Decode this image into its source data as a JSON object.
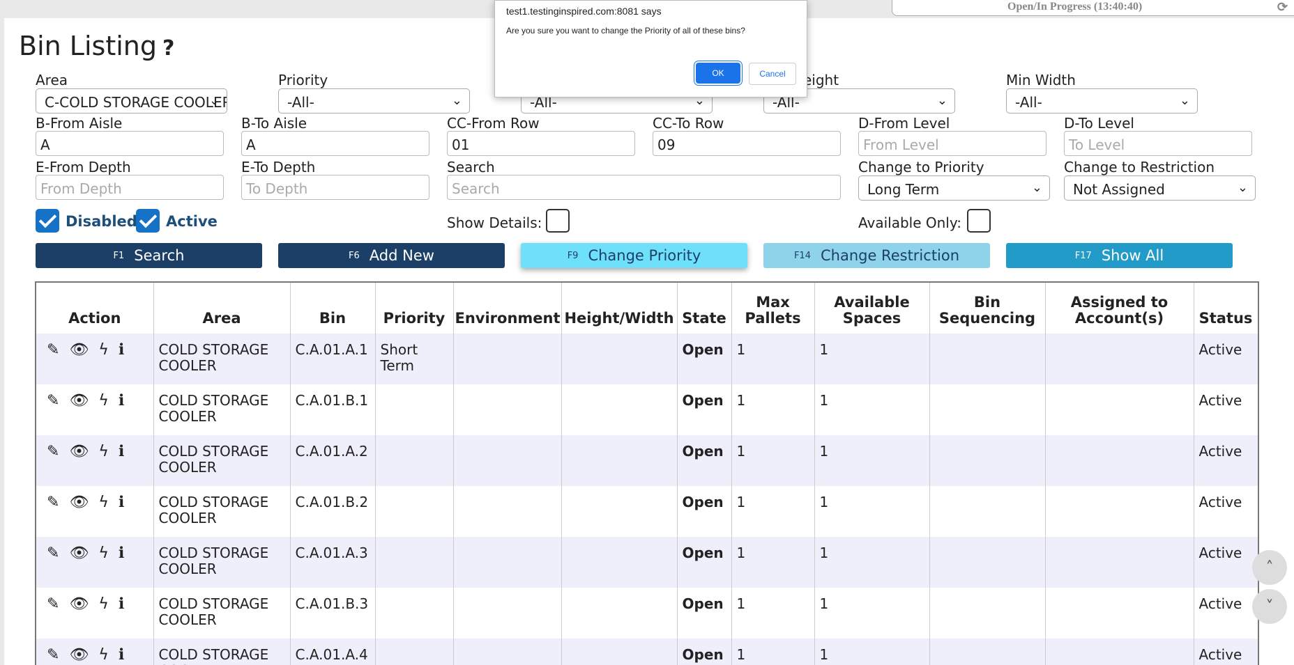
{
  "status": {
    "text": "Open/In Progress (13:40:40)",
    "refresh_icon": "refresh-icon"
  },
  "page": {
    "title": "Bin Listing",
    "help": "?"
  },
  "filters": {
    "area": {
      "label": "Area",
      "value": "C-COLD STORAGE COOLER"
    },
    "priority": {
      "label": "Priority",
      "value": "-All-"
    },
    "environment": {
      "label": "",
      "value": "-All-"
    },
    "min_height": {
      "label": "eight",
      "value": "-All-"
    },
    "min_width": {
      "label": "Min Width",
      "value": "-All-"
    },
    "from_aisle": {
      "label": "B-From Aisle",
      "value": "A"
    },
    "to_aisle": {
      "label": "B-To Aisle",
      "value": "A"
    },
    "from_row": {
      "label": "CC-From Row",
      "value": "01"
    },
    "to_row": {
      "label": "CC-To Row",
      "value": "09"
    },
    "from_level": {
      "label": "D-From Level",
      "placeholder": "From Level"
    },
    "to_level": {
      "label": "D-To Level",
      "placeholder": "To Level"
    },
    "from_depth": {
      "label": "E-From Depth",
      "placeholder": "From Depth"
    },
    "to_depth": {
      "label": "E-To Depth",
      "placeholder": "To Depth"
    },
    "search": {
      "label": "Search",
      "placeholder": "Search"
    },
    "change_priority": {
      "label": "Change to Priority",
      "value": "Long Term"
    },
    "change_restriction": {
      "label": "Change to Restriction",
      "value": "Not Assigned"
    },
    "disabled": {
      "label": "Disabled",
      "checked": true
    },
    "active": {
      "label": "Active",
      "checked": true
    },
    "show_details": {
      "label": "Show Details:",
      "checked": false
    },
    "available_only": {
      "label": "Available Only:",
      "checked": false
    }
  },
  "buttons": {
    "search": {
      "key": "F1",
      "label": "Search"
    },
    "add_new": {
      "key": "F6",
      "label": "Add New"
    },
    "change_priority": {
      "key": "F9",
      "label": "Change Priority"
    },
    "change_restriction": {
      "key": "F14",
      "label": "Change Restriction"
    },
    "show_all": {
      "key": "F17",
      "label": "Show All"
    }
  },
  "table": {
    "headers": [
      "Action",
      "Area",
      "Bin",
      "Priority",
      "Environment",
      "Height/Width",
      "State",
      "Max Pallets",
      "Available Spaces",
      "Bin Sequencing",
      "Assigned to Account(s)",
      "Status"
    ],
    "rows": [
      {
        "area": "COLD STORAGE COOLER",
        "bin": "C.A.01.A.1",
        "priority": "Short Term",
        "environment": "",
        "height_width": "",
        "state": "Open",
        "max_pallets": "1",
        "available": "1",
        "sequencing": "",
        "assigned": "",
        "status": "Active"
      },
      {
        "area": "COLD STORAGE COOLER",
        "bin": "C.A.01.B.1",
        "priority": "",
        "environment": "",
        "height_width": "",
        "state": "Open",
        "max_pallets": "1",
        "available": "1",
        "sequencing": "",
        "assigned": "",
        "status": "Active"
      },
      {
        "area": "COLD STORAGE COOLER",
        "bin": "C.A.01.A.2",
        "priority": "",
        "environment": "",
        "height_width": "",
        "state": "Open",
        "max_pallets": "1",
        "available": "1",
        "sequencing": "",
        "assigned": "",
        "status": "Active"
      },
      {
        "area": "COLD STORAGE COOLER",
        "bin": "C.A.01.B.2",
        "priority": "",
        "environment": "",
        "height_width": "",
        "state": "Open",
        "max_pallets": "1",
        "available": "1",
        "sequencing": "",
        "assigned": "",
        "status": "Active"
      },
      {
        "area": "COLD STORAGE COOLER",
        "bin": "C.A.01.A.3",
        "priority": "",
        "environment": "",
        "height_width": "",
        "state": "Open",
        "max_pallets": "1",
        "available": "1",
        "sequencing": "",
        "assigned": "",
        "status": "Active"
      },
      {
        "area": "COLD STORAGE COOLER",
        "bin": "C.A.01.B.3",
        "priority": "",
        "environment": "",
        "height_width": "",
        "state": "Open",
        "max_pallets": "1",
        "available": "1",
        "sequencing": "",
        "assigned": "",
        "status": "Active"
      },
      {
        "area": "COLD STORAGE COOLER",
        "bin": "C.A.01.A.4",
        "priority": "",
        "environment": "",
        "height_width": "",
        "state": "Open",
        "max_pallets": "1",
        "available": "1",
        "sequencing": "",
        "assigned": "",
        "status": "Active"
      }
    ]
  },
  "dialog": {
    "title": "test1.testinginspired.com:8081 says",
    "message": "Are you sure you want to change the Priority of all of these bins?",
    "ok": "OK",
    "cancel": "Cancel"
  },
  "scroll": {
    "up": "˄",
    "down": "˅"
  }
}
